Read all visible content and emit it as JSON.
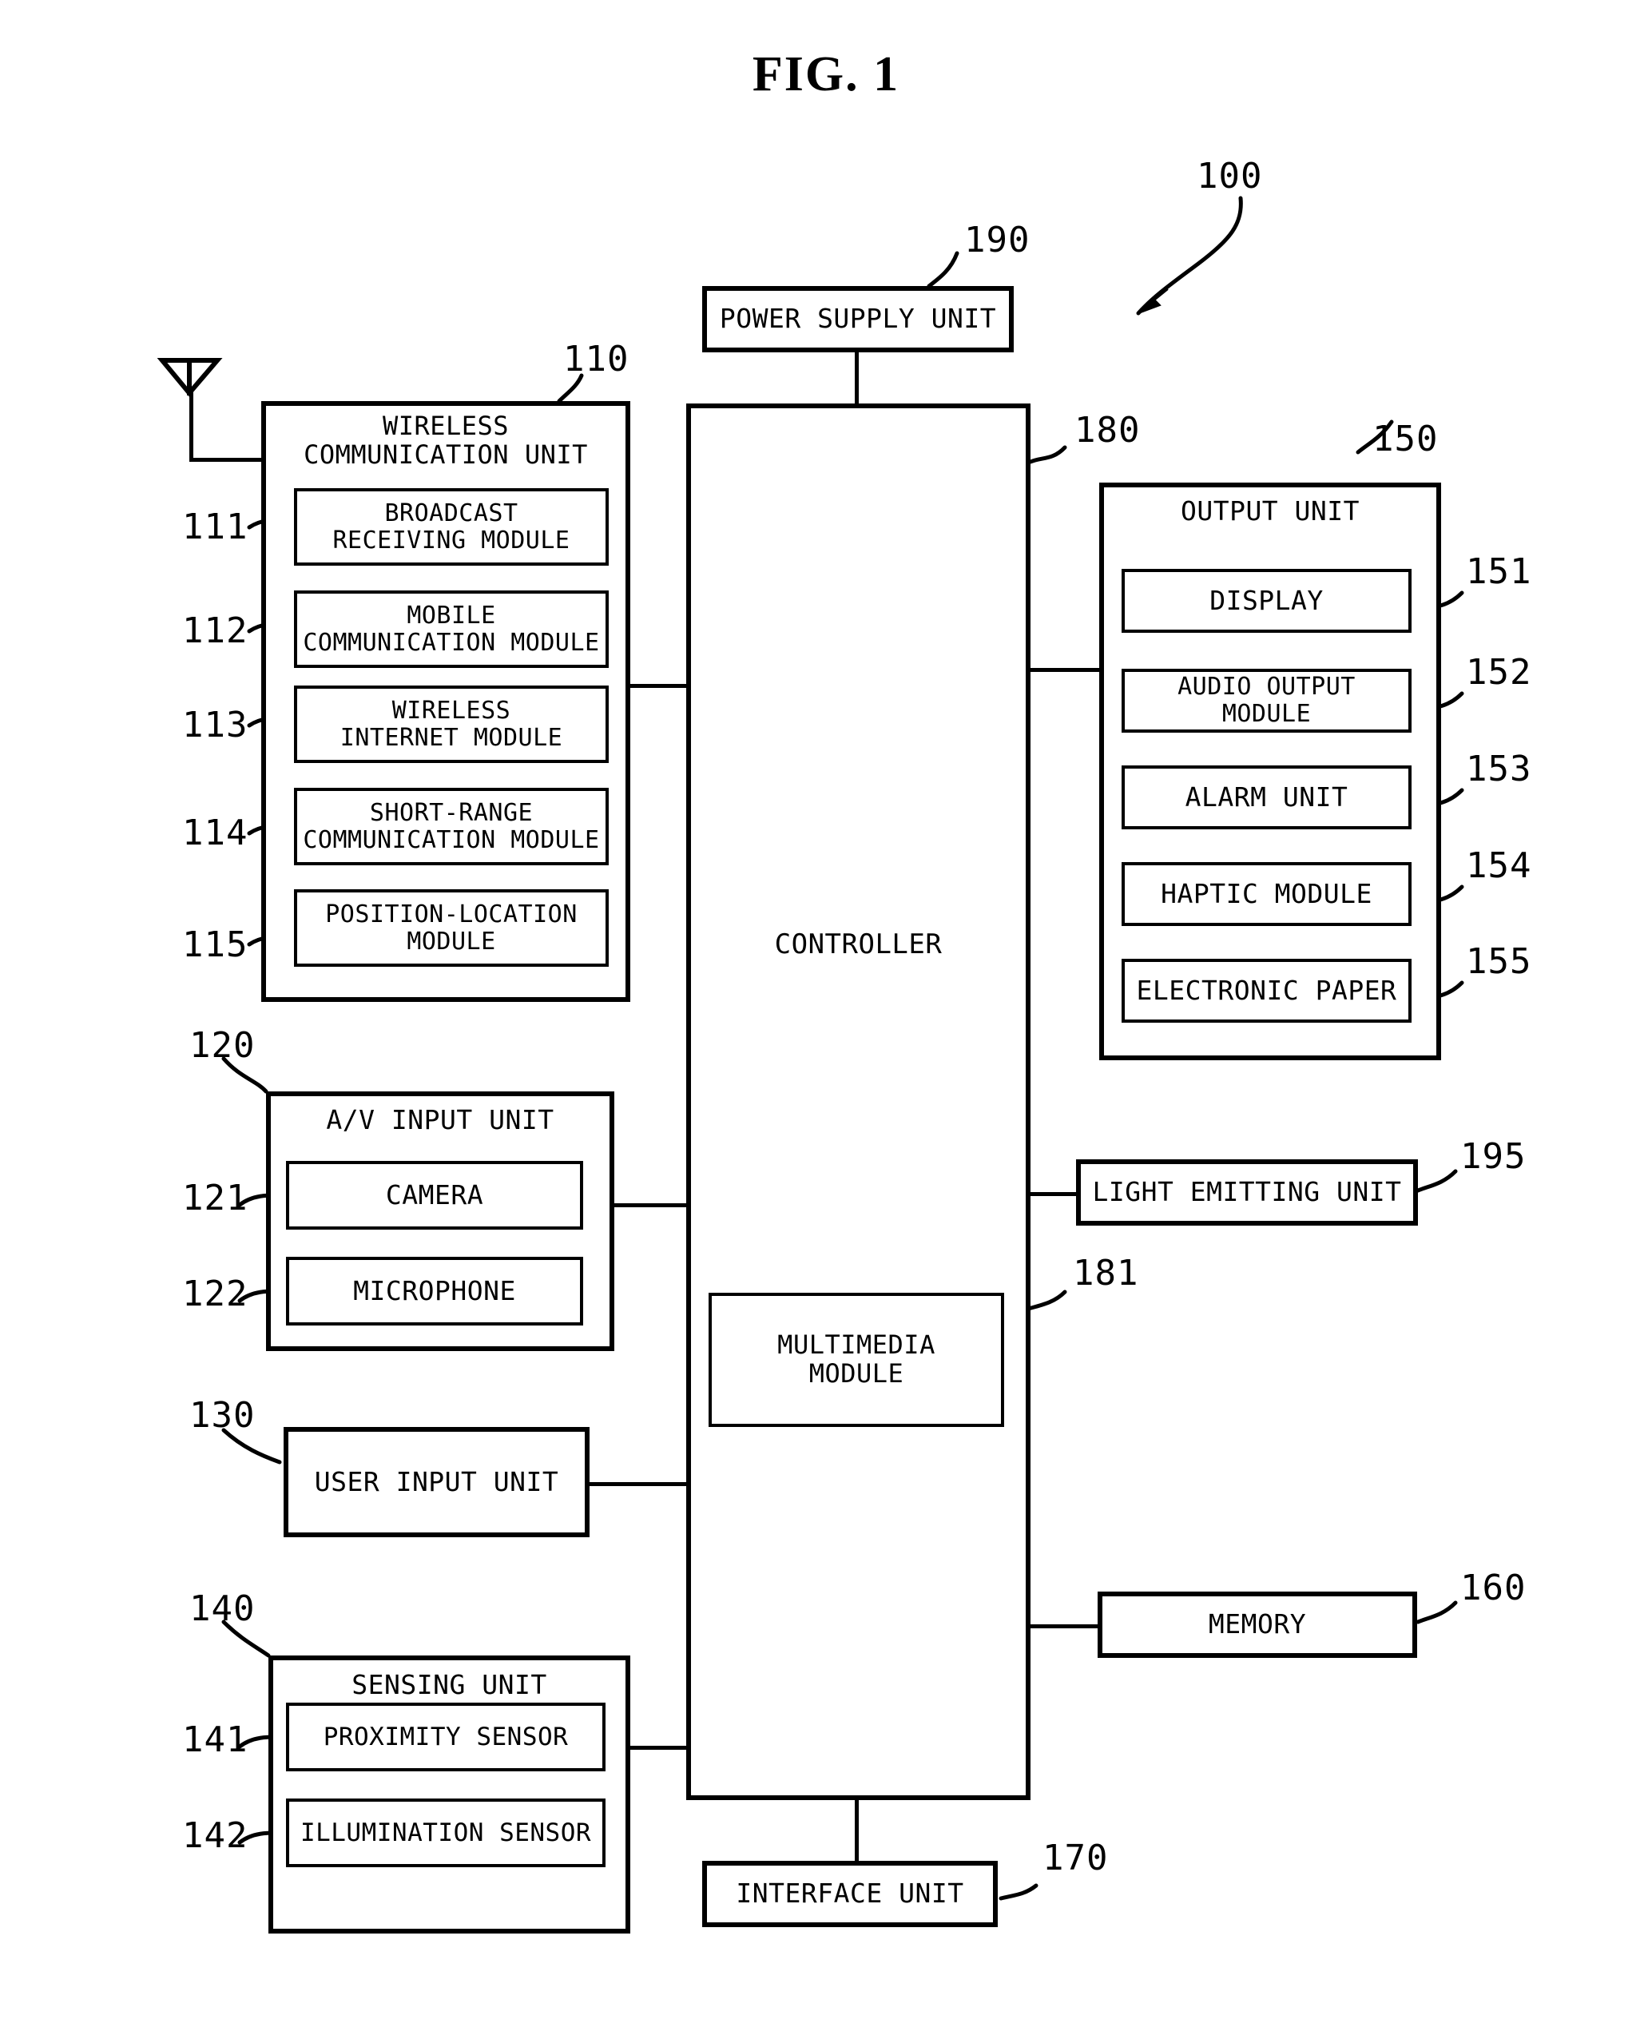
{
  "figure": {
    "title": "FIG. 1",
    "device_ref": "100"
  },
  "blocks": {
    "power_supply": {
      "label": "POWER SUPPLY UNIT",
      "ref": "190"
    },
    "controller": {
      "label": "CONTROLLER",
      "ref": "180"
    },
    "multimedia": {
      "label_line1": "MULTIMEDIA",
      "label_line2": "MODULE",
      "ref": "181"
    },
    "interface": {
      "label": "INTERFACE UNIT",
      "ref": "170"
    },
    "light_emitting": {
      "label": "LIGHT EMITTING UNIT",
      "ref": "195"
    },
    "memory": {
      "label": "MEMORY",
      "ref": "160"
    },
    "user_input": {
      "label": "USER INPUT UNIT",
      "ref": "130"
    }
  },
  "wireless_communication_unit": {
    "title_line1": "WIRELESS",
    "title_line2": "COMMUNICATION UNIT",
    "ref": "110",
    "modules": [
      {
        "ref": "111",
        "line1": "BROADCAST",
        "line2": "RECEIVING MODULE"
      },
      {
        "ref": "112",
        "line1": "MOBILE",
        "line2": "COMMUNICATION MODULE"
      },
      {
        "ref": "113",
        "line1": "WIRELESS",
        "line2": "INTERNET MODULE"
      },
      {
        "ref": "114",
        "line1": "SHORT-RANGE",
        "line2": "COMMUNICATION MODULE"
      },
      {
        "ref": "115",
        "line1": "POSITION-LOCATION",
        "line2": "MODULE"
      }
    ]
  },
  "av_input_unit": {
    "title": "A/V INPUT UNIT",
    "ref": "120",
    "modules": [
      {
        "ref": "121",
        "label": "CAMERA"
      },
      {
        "ref": "122",
        "label": "MICROPHONE"
      }
    ]
  },
  "sensing_unit": {
    "title": "SENSING UNIT",
    "ref": "140",
    "modules": [
      {
        "ref": "141",
        "label": "PROXIMITY SENSOR"
      },
      {
        "ref": "142",
        "label": "ILLUMINATION SENSOR"
      }
    ]
  },
  "output_unit": {
    "title": "OUTPUT UNIT",
    "ref": "150",
    "modules": [
      {
        "ref": "151",
        "label": "DISPLAY"
      },
      {
        "ref": "152",
        "label": "AUDIO OUTPUT MODULE"
      },
      {
        "ref": "153",
        "label": "ALARM UNIT"
      },
      {
        "ref": "154",
        "label": "HAPTIC MODULE"
      },
      {
        "ref": "155",
        "label": "ELECTRONIC PAPER"
      }
    ]
  },
  "icons": {
    "antenna": "antenna-icon"
  },
  "colors": {
    "ink": "#000000",
    "paper": "#ffffff"
  }
}
